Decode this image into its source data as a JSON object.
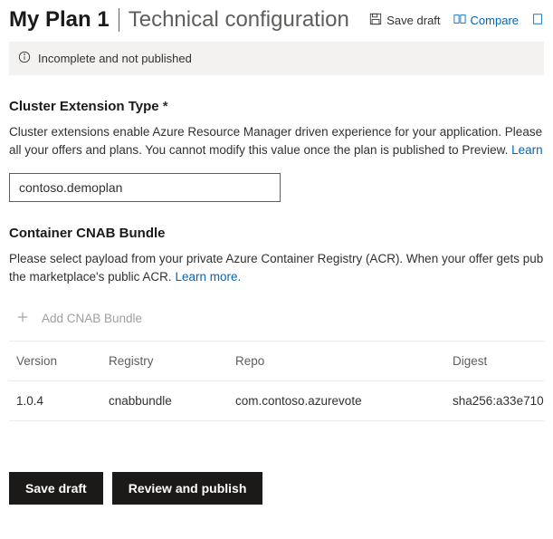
{
  "header": {
    "plan_name": "My Plan 1",
    "page_title": "Technical configuration",
    "save_draft_label": "Save draft",
    "compare_label": "Compare"
  },
  "status": {
    "text": "Incomplete and not published"
  },
  "cluster_extension": {
    "heading": "Cluster Extension Type",
    "required": "*",
    "help_part1": "Cluster extensions enable Azure Resource Manager driven experience for your application. Please",
    "help_part2": "all your offers and plans. You cannot modify this value once the plan is published to Preview.",
    "help_link": "Learn",
    "value": "contoso.demoplan"
  },
  "cnab": {
    "heading": "Container CNAB Bundle",
    "help_part1": "Please select payload from your private Azure Container Registry (ACR). When your offer gets pub",
    "help_part2": "the marketplace's public ACR.",
    "help_link": "Learn more",
    "add_label": "Add CNAB Bundle",
    "columns": {
      "version": "Version",
      "registry": "Registry",
      "repo": "Repo",
      "digest": "Digest"
    },
    "rows": [
      {
        "version": "1.0.4",
        "registry": "cnabbundle",
        "repo": "com.contoso.azurevote",
        "digest": "sha256:a33e710"
      }
    ]
  },
  "footer": {
    "save_draft": "Save draft",
    "review_publish": "Review and publish"
  }
}
